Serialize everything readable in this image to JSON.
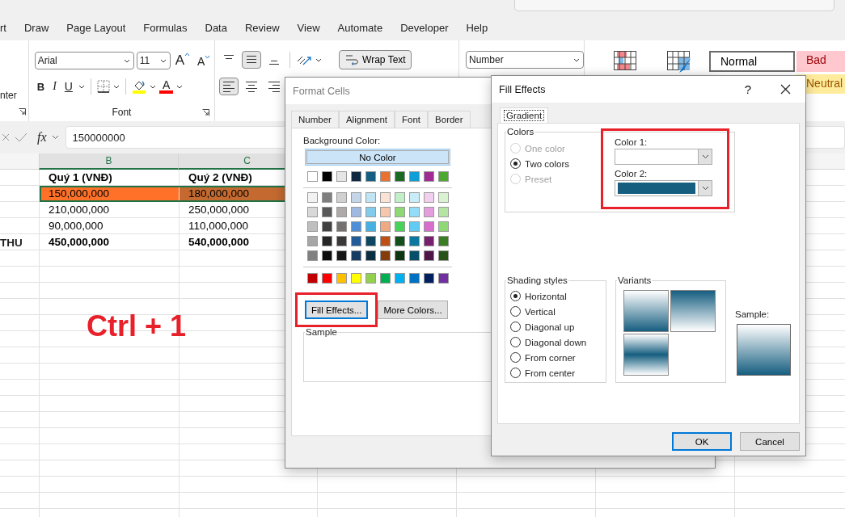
{
  "menu_tabs": [
    {
      "label": "rt",
      "selected": false
    },
    {
      "label": "Draw",
      "selected": false
    },
    {
      "label": "Page Layout",
      "selected": false
    },
    {
      "label": "Formulas",
      "selected": false
    },
    {
      "label": "Data",
      "selected": false
    },
    {
      "label": "Review",
      "selected": false
    },
    {
      "label": "View",
      "selected": false
    },
    {
      "label": "Automate",
      "selected": false
    },
    {
      "label": "Developer",
      "selected": false
    },
    {
      "label": "Help",
      "selected": false
    }
  ],
  "ribbon": {
    "merge_label": "nter",
    "font_name": "Arial",
    "font_size": "11",
    "grow_label": "A",
    "shrink_label": "A",
    "style_buttons": [
      "B",
      "I",
      "U"
    ],
    "fill_color": {
      "color": "#ffff00"
    },
    "font_color": {
      "label": "A",
      "color": "#ff0000"
    },
    "font_group_label": "Font",
    "vertical_align": [
      {
        "selected": false
      },
      {
        "selected": true
      },
      {
        "selected": false
      }
    ],
    "horizontal_align": [
      {
        "selected": true
      },
      {
        "selected": false
      },
      {
        "selected": false
      }
    ],
    "wrap_text": "Wrap Text",
    "number_format": "Number",
    "styles": [
      {
        "label": "Normal",
        "kind": "normal",
        "selected": true
      },
      {
        "label": "Bad",
        "kind": "bad",
        "selected": false
      },
      {
        "label": "Neutral",
        "kind": "neutral",
        "selected": false
      }
    ]
  },
  "formula_bar": {
    "function_label": "fx",
    "value": "150000000"
  },
  "sheet": {
    "columns": [
      {
        "label": "B",
        "selected": true
      },
      {
        "label": "C",
        "selected": true
      }
    ],
    "rows": [
      {
        "cells": [
          {
            "text": "Quý 1 (VNĐ)"
          },
          {
            "text": "Quý 2 (VNĐ)"
          }
        ],
        "bold": true,
        "selected": false
      },
      {
        "cells": [
          {
            "text": "150,000,000",
            "color": "#ff7128"
          },
          {
            "text": "180,000,000",
            "color": "#c46a30"
          }
        ],
        "bold": false,
        "selected": true
      },
      {
        "cells": [
          {
            "text": "210,000,000"
          },
          {
            "text": "250,000,000"
          }
        ],
        "bold": false,
        "selected": false
      },
      {
        "cells": [
          {
            "text": "90,000,000"
          },
          {
            "text": "110,000,000"
          }
        ],
        "bold": false,
        "selected": false
      },
      {
        "label": "THU",
        "cells": [
          {
            "text": "450,000,000"
          },
          {
            "text": "540,000,000"
          }
        ],
        "bold": true,
        "selected": false
      }
    ],
    "annotation": "Ctrl + 1"
  },
  "format_cells": {
    "title": "Format Cells",
    "tabs": [
      {
        "label": "Number",
        "selected": false
      },
      {
        "label": "Alignment",
        "selected": false
      },
      {
        "label": "Font",
        "selected": false
      },
      {
        "label": "Border",
        "selected": false
      }
    ],
    "background_label": "Background Color:",
    "no_color": "No Color",
    "theme_colors": [
      {
        "color": "#ffffff"
      },
      {
        "color": "#000000"
      },
      {
        "color": "#e7e6e6"
      },
      {
        "color": "#0e2841"
      },
      {
        "color": "#156082"
      },
      {
        "color": "#e97132"
      },
      {
        "color": "#196b24"
      },
      {
        "color": "#0f9ed5"
      },
      {
        "color": "#a02b93"
      },
      {
        "color": "#4ea72e"
      }
    ],
    "shade_rows": [
      {
        "swatches": [
          {
            "color": "#f2f2f2"
          },
          {
            "color": "#7f7f7f"
          },
          {
            "color": "#d0d0d0"
          },
          {
            "color": "#c4d5e8"
          },
          {
            "color": "#c0e4f5"
          },
          {
            "color": "#fbe2d5"
          },
          {
            "color": "#c1f0c8"
          },
          {
            "color": "#c9ecf9"
          },
          {
            "color": "#f2ceef"
          },
          {
            "color": "#d9f2d0"
          }
        ]
      },
      {
        "swatches": [
          {
            "color": "#d9d9d9"
          },
          {
            "color": "#595959"
          },
          {
            "color": "#aeaaaa"
          },
          {
            "color": "#a0b9e0"
          },
          {
            "color": "#83cbeb"
          },
          {
            "color": "#f7c7ac"
          },
          {
            "color": "#8ed973"
          },
          {
            "color": "#94dcf8"
          },
          {
            "color": "#e59edd"
          },
          {
            "color": "#b4e5a2"
          }
        ]
      },
      {
        "swatches": [
          {
            "color": "#bfbfbf"
          },
          {
            "color": "#404040"
          },
          {
            "color": "#757171"
          },
          {
            "color": "#4e8fd8"
          },
          {
            "color": "#45b0e1"
          },
          {
            "color": "#f1a983"
          },
          {
            "color": "#47d359"
          },
          {
            "color": "#61cbf3"
          },
          {
            "color": "#d86dcd"
          },
          {
            "color": "#8ed973"
          }
        ]
      },
      {
        "swatches": [
          {
            "color": "#a6a6a6"
          },
          {
            "color": "#262626"
          },
          {
            "color": "#3a3838"
          },
          {
            "color": "#215c98"
          },
          {
            "color": "#0f4761"
          },
          {
            "color": "#c04f15"
          },
          {
            "color": "#124f1a"
          },
          {
            "color": "#0b76a0"
          },
          {
            "color": "#77206d"
          },
          {
            "color": "#3b7d23"
          }
        ]
      },
      {
        "swatches": [
          {
            "color": "#808080"
          },
          {
            "color": "#0d0d0d"
          },
          {
            "color": "#161616"
          },
          {
            "color": "#153d64"
          },
          {
            "color": "#0a2f41"
          },
          {
            "color": "#843c0c"
          },
          {
            "color": "#0d3512"
          },
          {
            "color": "#074f69"
          },
          {
            "color": "#4f1548"
          },
          {
            "color": "#275317"
          }
        ]
      }
    ],
    "standard_colors": [
      {
        "color": "#c00000"
      },
      {
        "color": "#ff0000"
      },
      {
        "color": "#ffc000"
      },
      {
        "color": "#ffff00"
      },
      {
        "color": "#92d050"
      },
      {
        "color": "#00b050"
      },
      {
        "color": "#00b0f0"
      },
      {
        "color": "#0070c0"
      },
      {
        "color": "#002060"
      },
      {
        "color": "#7030a0"
      }
    ],
    "buttons": [
      {
        "label": "Fill Effects...",
        "highlighted": true
      },
      {
        "label": "More Colors...",
        "highlighted": false
      }
    ],
    "sample_label": "Sample"
  },
  "fill_effects": {
    "title": "Fill Effects",
    "help": "?",
    "tabs": [
      {
        "label": "Gradient",
        "selected": true
      }
    ],
    "colors_label": "Colors",
    "color_modes": [
      {
        "label": "One color",
        "selected": false,
        "disabled": true
      },
      {
        "label": "Two colors",
        "selected": true,
        "disabled": false
      },
      {
        "label": "Preset",
        "selected": false,
        "disabled": true
      }
    ],
    "pickers_highlighted": true,
    "color_1": {
      "label": "Color 1:",
      "color": "#ffffff"
    },
    "color_2": {
      "label": "Color 2:",
      "color": "#165e80"
    },
    "shading_label": "Shading styles",
    "shading_styles": [
      {
        "label": "Horizontal",
        "selected": true
      },
      {
        "label": "Vertical",
        "selected": false
      },
      {
        "label": "Diagonal up",
        "selected": false
      },
      {
        "label": "Diagonal down",
        "selected": false
      },
      {
        "label": "From corner",
        "selected": false
      },
      {
        "label": "From center",
        "selected": false
      }
    ],
    "variants_label": "Variants",
    "variants": [
      {
        "kind": "dark-bottom"
      },
      {
        "kind": "dark-top"
      },
      {
        "kind": "dark-middle"
      }
    ],
    "sample_label": "Sample:",
    "buttons": [
      {
        "label": "OK",
        "default": true
      },
      {
        "label": "Cancel",
        "default": false
      }
    ]
  }
}
